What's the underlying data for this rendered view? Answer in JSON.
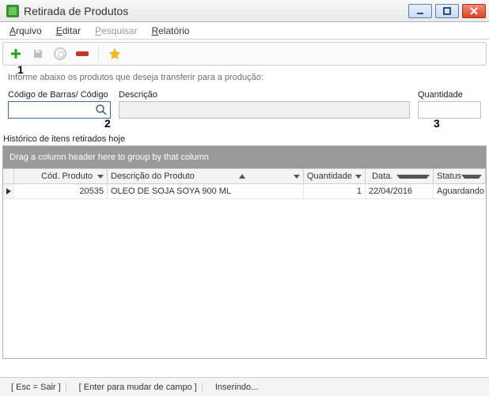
{
  "window": {
    "title": "Retirada de Produtos"
  },
  "menu": {
    "arquivo": "Arquivo",
    "editar": "Editar",
    "pesquisar": "Pesquisar",
    "relatorio": "Relatório"
  },
  "callouts": {
    "one": "1",
    "two": "2",
    "three": "3"
  },
  "form": {
    "instruction": "Informe abaixo os produtos que deseja transferir para a produção:",
    "codigo_label": "Código de Barras/ Código",
    "descricao_label": "Descrição",
    "quantidade_label": "Quantidade",
    "codigo_value": "",
    "descricao_value": "",
    "quantidade_value": ""
  },
  "history": {
    "label": "Histórico de itens retirados hoje",
    "group_hint": "Drag a column header here to group by that column",
    "columns": {
      "cod": "Cód. Produto",
      "desc": "Descrição do Produto",
      "qtd": "Quantidade",
      "data": "Data.",
      "status": "Status"
    },
    "rows": [
      {
        "cod": "20535",
        "desc": "OLEO DE SOJA SOYA 900 ML",
        "qtd": "1",
        "data": "22/04/2016",
        "status": "Aguardando"
      }
    ]
  },
  "statusbar": {
    "esc": "[ Esc = Sair ]",
    "enter": "[ Enter para mudar de campo ]",
    "mode": "Inserindo..."
  }
}
